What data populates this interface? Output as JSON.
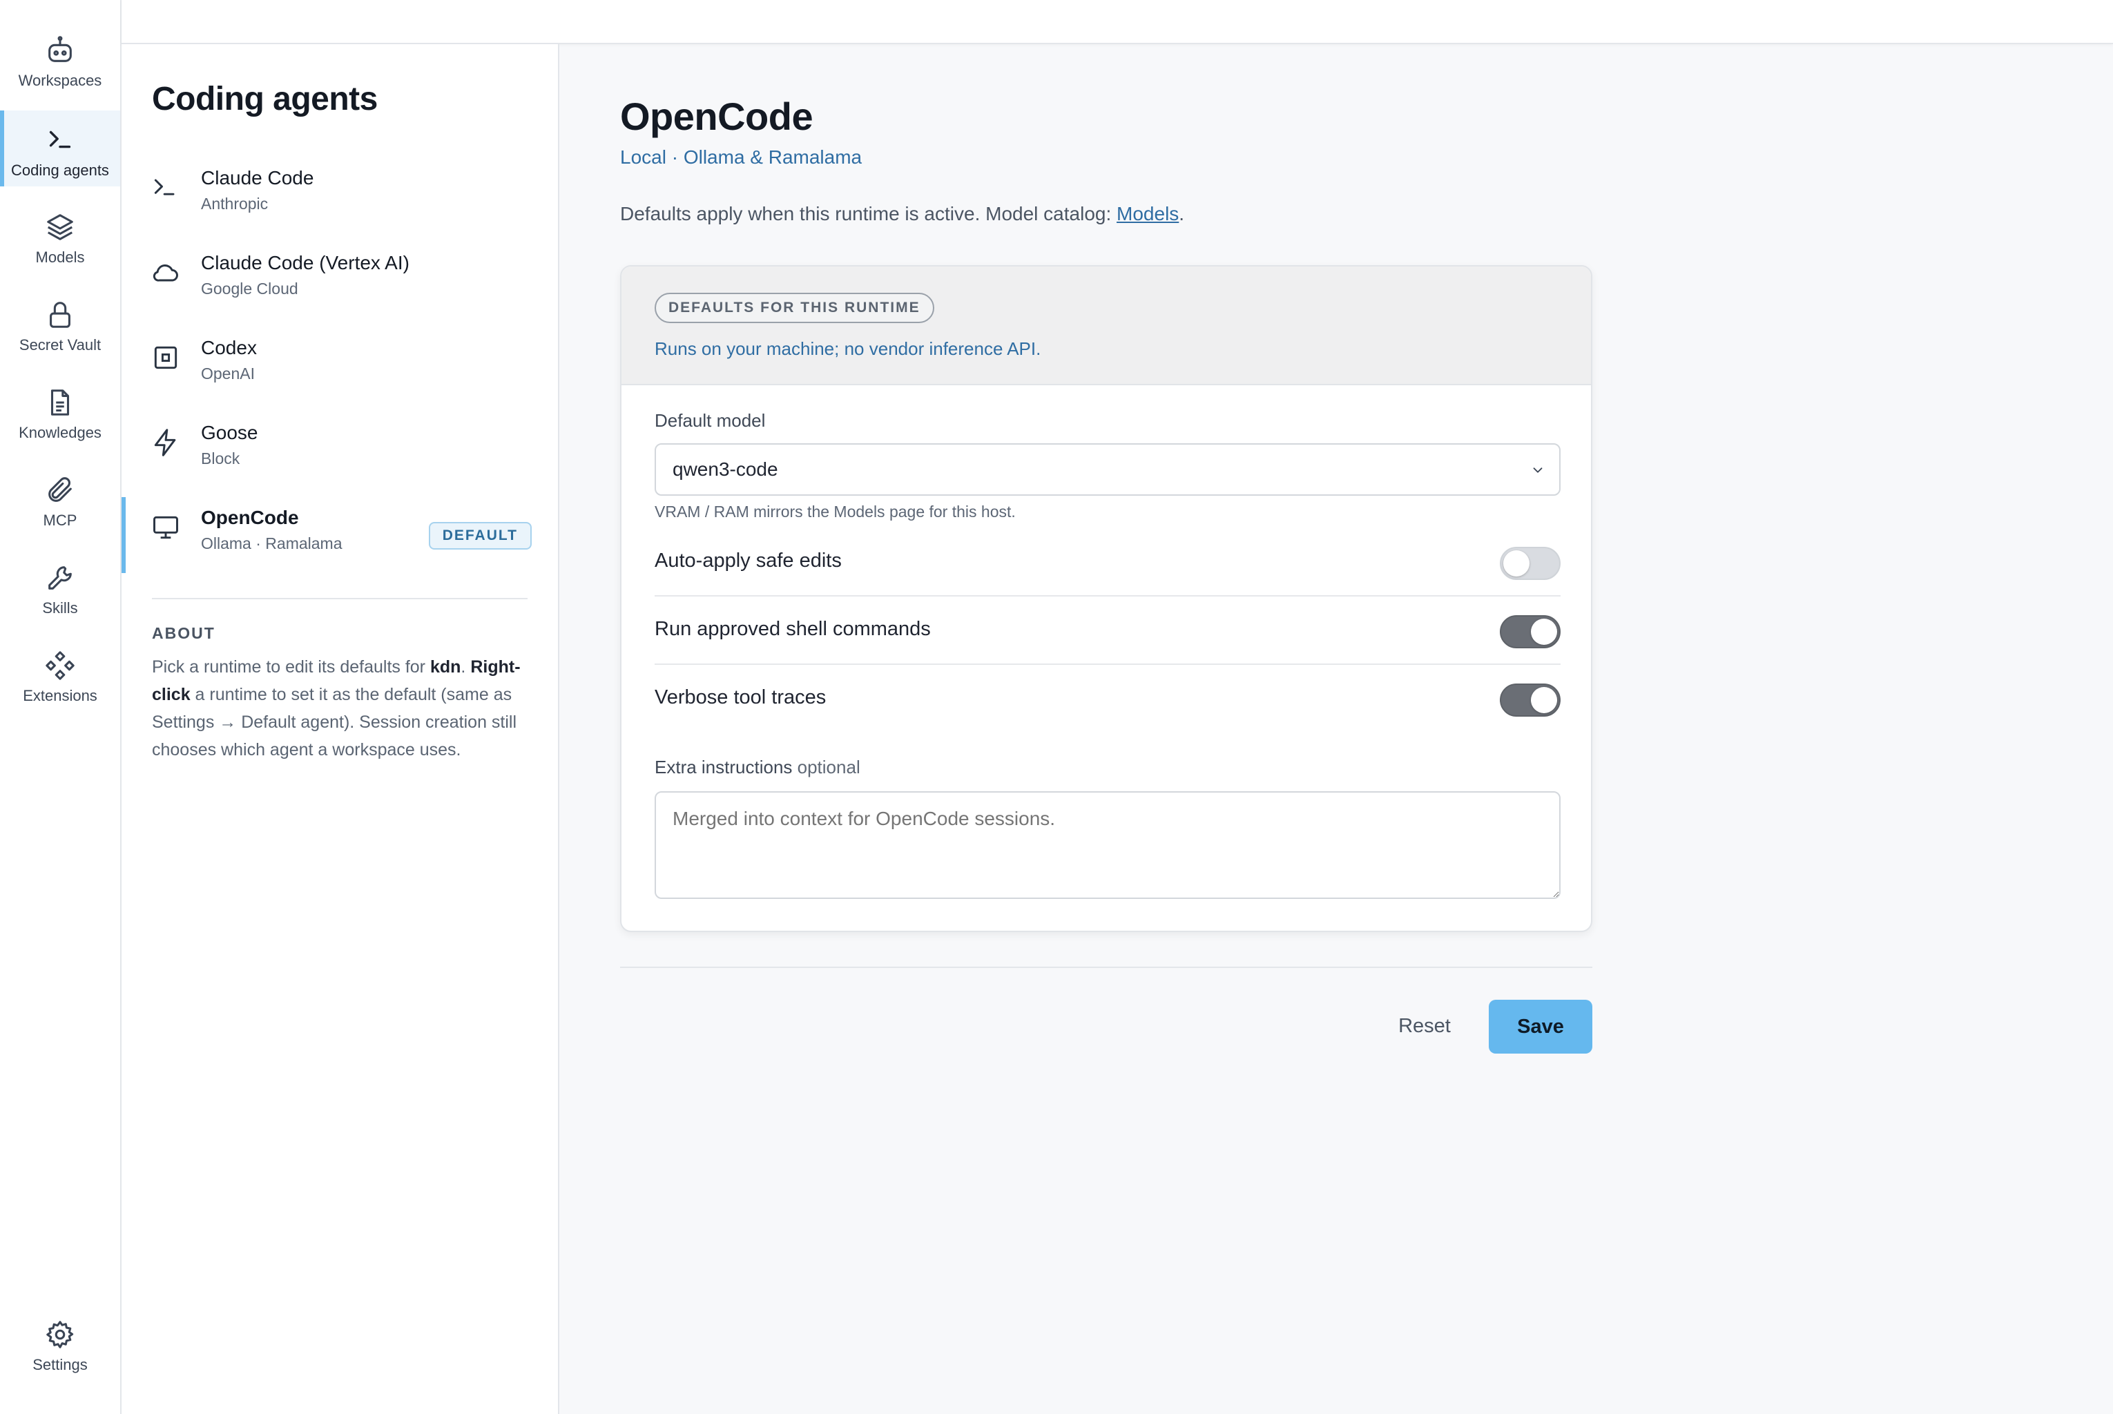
{
  "nav": {
    "items": [
      {
        "label": "Workspaces",
        "icon": "robot-icon"
      },
      {
        "label": "Coding agents",
        "icon": "terminal-icon"
      },
      {
        "label": "Models",
        "icon": "layers-icon"
      },
      {
        "label": "Secret Vault",
        "icon": "lock-icon"
      },
      {
        "label": "Knowledges",
        "icon": "document-icon"
      },
      {
        "label": "MCP",
        "icon": "paperclip-icon"
      },
      {
        "label": "Skills",
        "icon": "wrench-icon"
      },
      {
        "label": "Extensions",
        "icon": "extensions-icon"
      }
    ],
    "settings_label": "Settings",
    "active_index": 1,
    "accent_color": "#6bb9ec"
  },
  "list": {
    "title": "Coding agents",
    "agents": [
      {
        "name": "Claude Code",
        "sub": "Anthropic",
        "icon": "terminal-icon"
      },
      {
        "name": "Claude Code (Vertex AI)",
        "sub": "Google Cloud",
        "icon": "cloud-icon"
      },
      {
        "name": "Codex",
        "sub": "OpenAI",
        "icon": "chip-icon"
      },
      {
        "name": "Goose",
        "sub": "Block",
        "icon": "lightning-icon"
      },
      {
        "name": "OpenCode",
        "sub": "Ollama · Ramalama",
        "icon": "monitor-icon",
        "badge": "DEFAULT",
        "selected": true
      }
    ],
    "about": {
      "heading": "ABOUT",
      "text_1": "Pick a runtime to edit its defaults for ",
      "bold_1": "kdn",
      "text_2": ". ",
      "bold_2": "Right-click",
      "text_3": " a runtime to set it as the default (same as Settings → Default agent). Session creation still chooses which agent a workspace uses."
    }
  },
  "main": {
    "title": "OpenCode",
    "subtitle": "Local · Ollama & Ramalama",
    "description_prefix": "Defaults apply when this runtime is active. Model catalog: ",
    "description_link": "Models",
    "description_suffix": ".",
    "card": {
      "pill": "DEFAULTS FOR THIS RUNTIME",
      "note": "Runs on your machine; no vendor inference API.",
      "default_model_label": "Default model",
      "default_model_value": "qwen3-code",
      "hint": "VRAM / RAM mirrors the Models page for this host.",
      "toggles": [
        {
          "label": "Auto-apply safe edits",
          "on": false
        },
        {
          "label": "Run approved shell commands",
          "on": true
        },
        {
          "label": "Verbose tool traces",
          "on": true
        }
      ],
      "extra_label": "Extra instructions",
      "extra_optional": "optional",
      "extra_placeholder": "Merged into context for OpenCode sessions."
    },
    "reset_label": "Reset",
    "save_label": "Save",
    "save_color": "#65b8ee"
  }
}
